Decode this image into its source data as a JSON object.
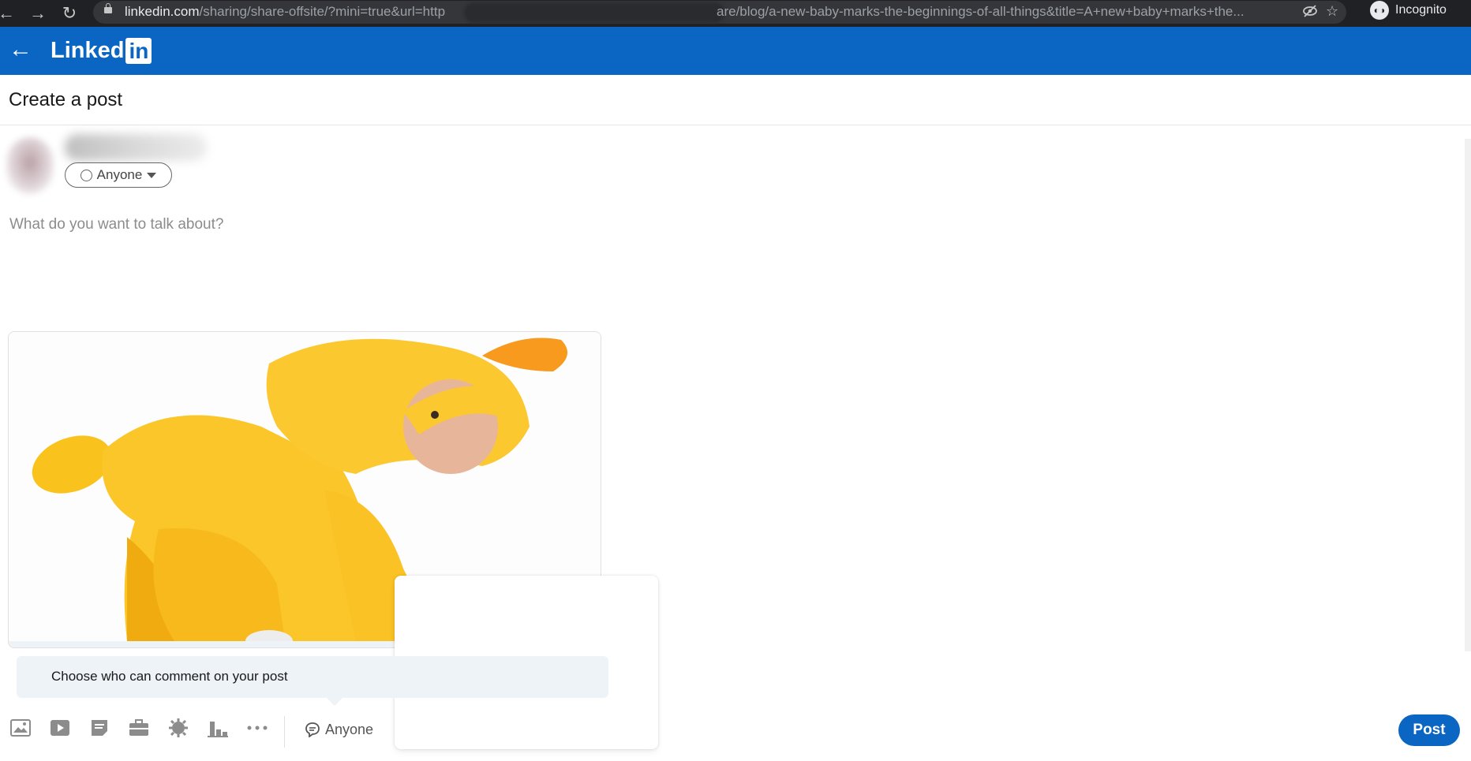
{
  "browser": {
    "url_host": "linkedin.com",
    "url_path_start": "/sharing/share-offsite/?mini=true&url=http",
    "url_path_end": "are/blog/a-new-baby-marks-the-beginnings-of-all-things&title=A+new+baby+marks+the...",
    "incognito_label": "Incognito",
    "icons": [
      "back-arrow-icon",
      "forward-arrow-icon",
      "reload-icon",
      "lock-icon",
      "eye-off-icon",
      "star-icon",
      "incognito-icon"
    ]
  },
  "header": {
    "logo_text": "Linked",
    "logo_badge": "in",
    "brand_color": "#0a66c2"
  },
  "page": {
    "title": "Create a post"
  },
  "author": {
    "visibility_label": "Anyone"
  },
  "composer": {
    "placeholder": "What do you want to talk about?"
  },
  "preview": {
    "image_description_icon": "link-preview-image"
  },
  "tooltip": {
    "text": "Choose who can comment on your post"
  },
  "toolbar": {
    "tools": [
      "add-photo-icon",
      "add-video-icon",
      "add-document-icon",
      "share-job-icon",
      "celebrate-icon",
      "create-poll-icon",
      "more-icon"
    ],
    "comment_control_label": "Anyone",
    "post_label": "Post"
  }
}
